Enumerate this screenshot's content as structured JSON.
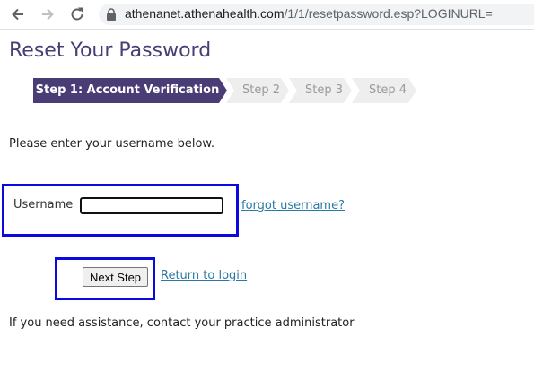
{
  "browser": {
    "url_host": "athenanet.athenahealth.com",
    "url_path": "/1/1/resetpassword.esp?LOGINURL=",
    "icons": {
      "back": "arrow-left-icon",
      "forward": "arrow-right-icon",
      "reload": "reload-icon",
      "lock": "lock-icon"
    }
  },
  "page": {
    "title": "Reset Your Password",
    "steps": [
      {
        "label": "Step 1: Account Verification",
        "active": true
      },
      {
        "label": "Step 2",
        "active": false
      },
      {
        "label": "Step 3",
        "active": false
      },
      {
        "label": "Step 4",
        "active": false
      }
    ],
    "instruction": "Please enter your username below.",
    "username_label": "Username",
    "username_value": "",
    "forgot_username": "forgot username?",
    "next_button": "Next Step",
    "return_link": "Return to login",
    "assistance": "If you need assistance, contact your practice administrator"
  },
  "colors": {
    "accent": "#4a3d75",
    "link": "#2a7aa5",
    "highlight_box": "#0a0ae0",
    "step_inactive_bg": "#eeeeee"
  }
}
